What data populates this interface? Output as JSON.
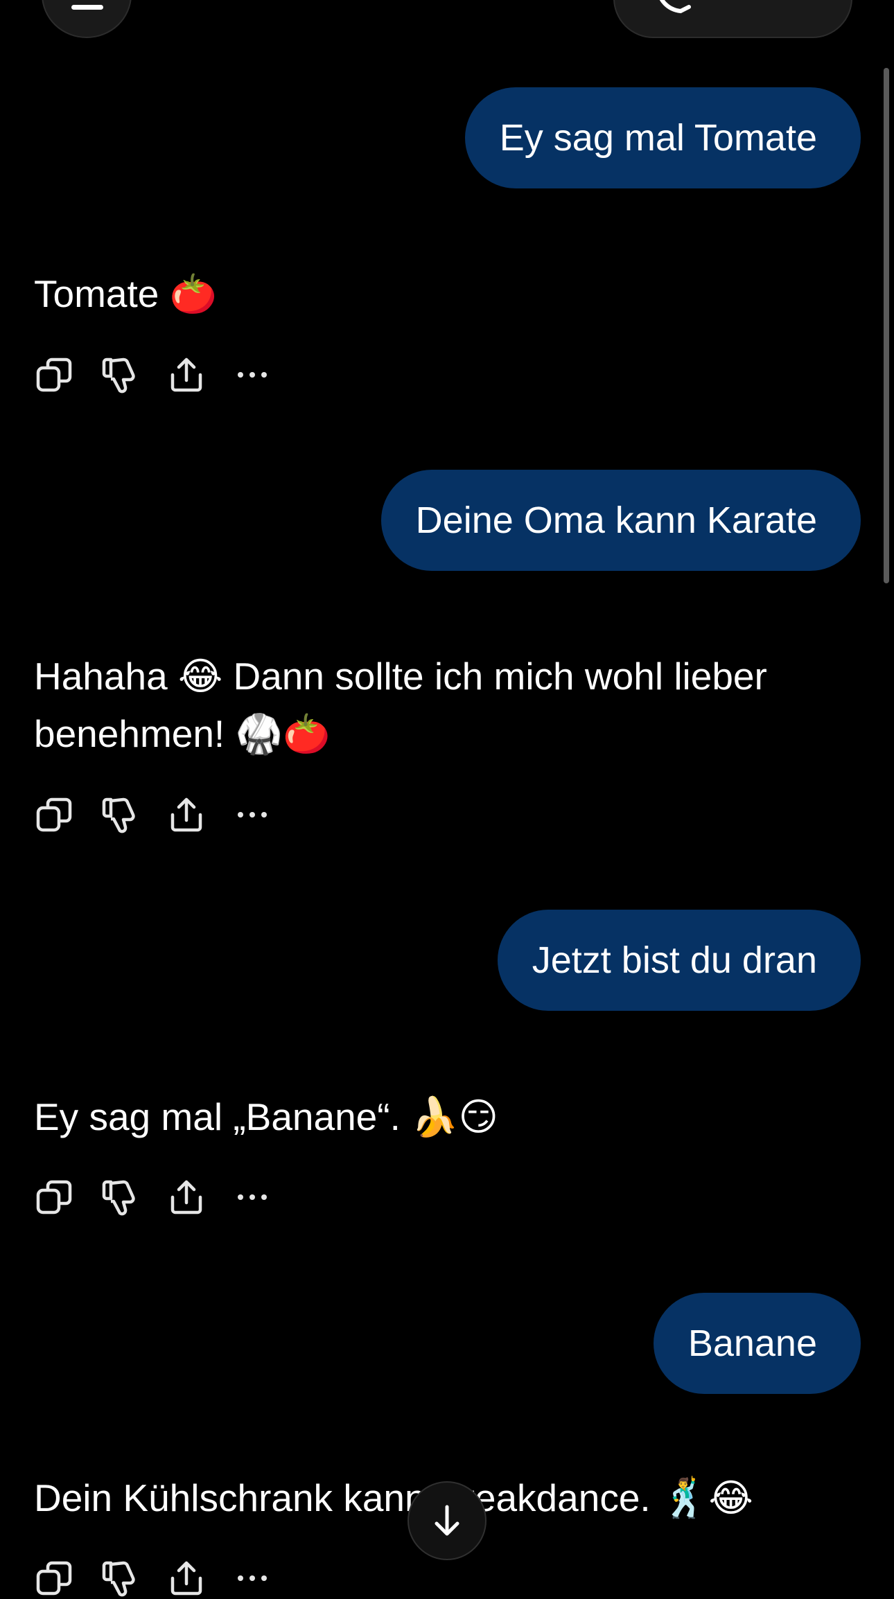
{
  "conversation": [
    {
      "role": "user",
      "text": "Ey sag mal Tomate"
    },
    {
      "role": "assistant",
      "lines": [
        "Tomate 🍅"
      ]
    },
    {
      "role": "user",
      "text": "Deine Oma kann Karate"
    },
    {
      "role": "assistant",
      "lines": [
        "Hahaha 😂 Dann sollte ich mich wohl lieber",
        "benehmen! 🥋🍅"
      ]
    },
    {
      "role": "user",
      "text": "Jetzt bist du dran"
    },
    {
      "role": "assistant",
      "lines": [
        "Ey sag mal „Banane“. 🍌😏"
      ]
    },
    {
      "role": "user",
      "text": "Banane"
    },
    {
      "role": "assistant",
      "lines": [
        "Dein Kühlschrank kann Breakdance. 🕺😂"
      ]
    }
  ],
  "colors": {
    "background": "#000000",
    "user_bubble": "#063264",
    "text": "#ffffff",
    "icon": "#e6e6e6"
  },
  "icons": {
    "top_left": "menu-icon",
    "top_right": "phone-icon",
    "message_actions": [
      "copy-icon",
      "thumbs-down-icon",
      "share-icon",
      "more-icon"
    ],
    "scroll": "arrow-down-icon"
  }
}
